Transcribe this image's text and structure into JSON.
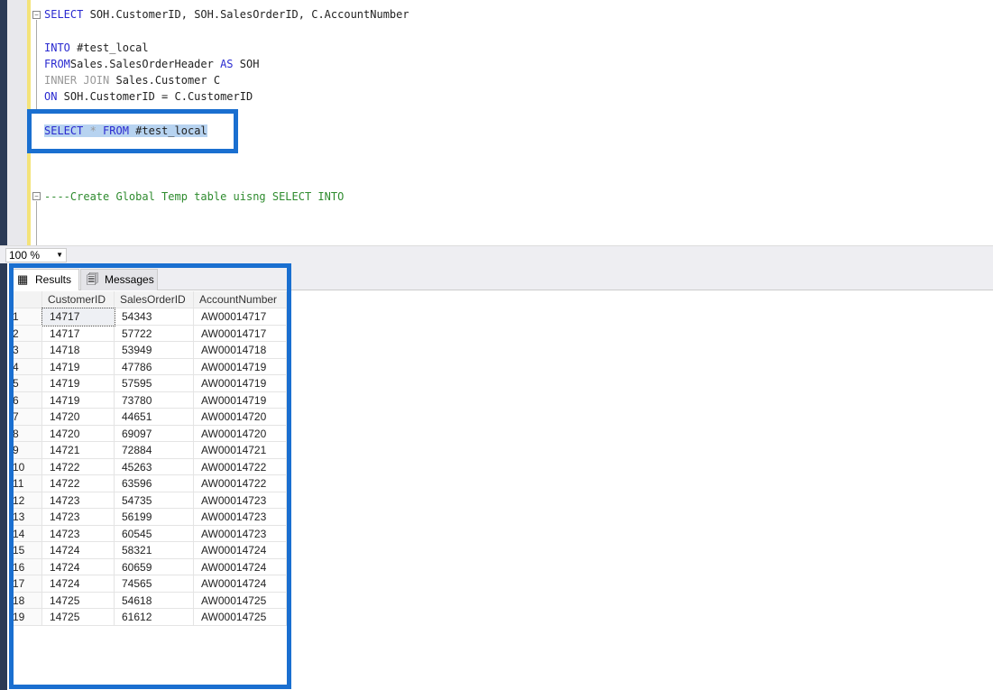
{
  "editor": {
    "lines": [
      {
        "parts": [
          [
            "kw",
            "SELECT"
          ],
          [
            "",
            "SOH.CustomerID, SOH.SalesOrderID, C.AccountNumber"
          ]
        ]
      },
      {
        "parts": [
          [
            "kw",
            "INTO"
          ],
          [
            "",
            "#test_local"
          ]
        ]
      },
      {
        "parts": [
          [
            "kw",
            "FROM"
          ],
          [
            "",
            "Sales.SalesOrderHeader "
          ],
          [
            "kw",
            "AS"
          ],
          [
            "",
            " SOH"
          ]
        ]
      },
      {
        "parts": [
          [
            "gr",
            "INNER JOIN"
          ],
          [
            "",
            " Sales.Customer C"
          ]
        ]
      },
      {
        "parts": [
          [
            "kw",
            "ON"
          ],
          [
            "",
            " SOH.CustomerID = C.CustomerID"
          ]
        ]
      },
      {
        "parts": [
          [
            "kw sel",
            "SELECT"
          ],
          [
            "gr sel",
            " * "
          ],
          [
            "kw sel",
            "FROM"
          ],
          [
            "sel",
            " #test_local"
          ]
        ]
      },
      {
        "parts": [
          [
            "cm",
            "----Create Global Temp table uisng SELECT INTO"
          ]
        ]
      }
    ]
  },
  "zoom": {
    "value": "100 %"
  },
  "results": {
    "tabs": [
      {
        "label": "Results",
        "icon": "grid-icon"
      },
      {
        "label": "Messages",
        "icon": "messages-icon"
      }
    ],
    "columns": [
      "CustomerID",
      "SalesOrderID",
      "AccountNumber"
    ],
    "rows": [
      [
        "1",
        "14717",
        "54343",
        "AW00014717"
      ],
      [
        "2",
        "14717",
        "57722",
        "AW00014717"
      ],
      [
        "3",
        "14718",
        "53949",
        "AW00014718"
      ],
      [
        "4",
        "14719",
        "47786",
        "AW00014719"
      ],
      [
        "5",
        "14719",
        "57595",
        "AW00014719"
      ],
      [
        "6",
        "14719",
        "73780",
        "AW00014719"
      ],
      [
        "7",
        "14720",
        "44651",
        "AW00014720"
      ],
      [
        "8",
        "14720",
        "69097",
        "AW00014720"
      ],
      [
        "9",
        "14721",
        "72884",
        "AW00014721"
      ],
      [
        "10",
        "14722",
        "45263",
        "AW00014722"
      ],
      [
        "11",
        "14722",
        "63596",
        "AW00014722"
      ],
      [
        "12",
        "14723",
        "54735",
        "AW00014723"
      ],
      [
        "13",
        "14723",
        "56199",
        "AW00014723"
      ],
      [
        "14",
        "14723",
        "60545",
        "AW00014723"
      ],
      [
        "15",
        "14724",
        "58321",
        "AW00014724"
      ],
      [
        "16",
        "14724",
        "60659",
        "AW00014724"
      ],
      [
        "17",
        "14724",
        "74565",
        "AW00014724"
      ],
      [
        "18",
        "14725",
        "54618",
        "AW00014725"
      ],
      [
        "19",
        "14725",
        "61612",
        "AW00014725"
      ]
    ]
  },
  "colors": {
    "highlight_box": "#1a6fd0",
    "keyword": "#2a2ad0",
    "comment": "#2e8b2e",
    "selection": "#b7d3f0"
  }
}
